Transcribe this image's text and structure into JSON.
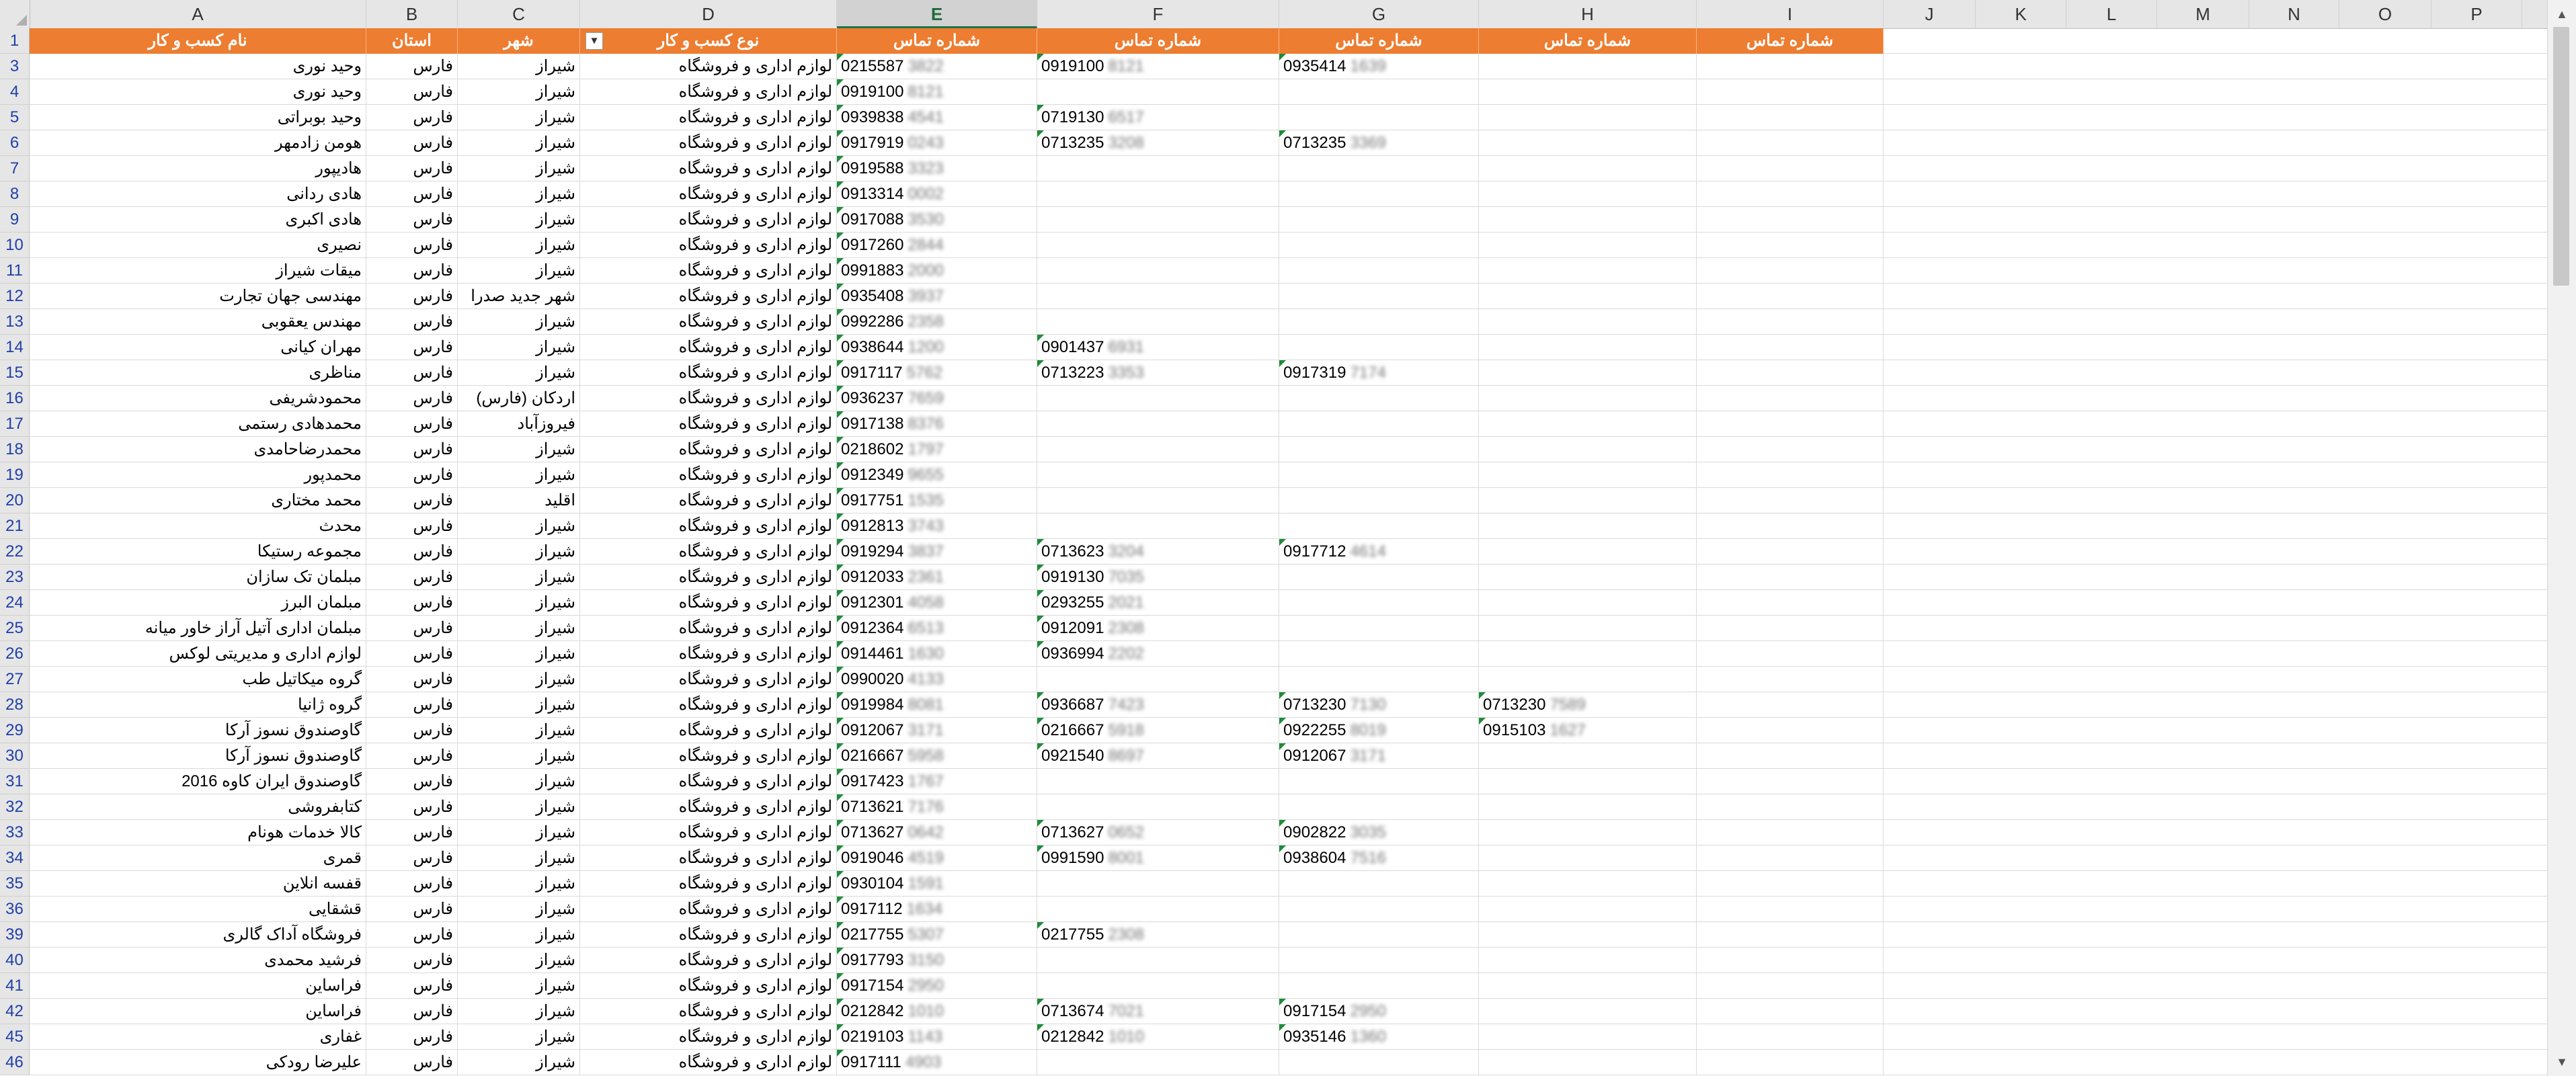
{
  "columns": {
    "A": "A",
    "B": "B",
    "C": "C",
    "D": "D",
    "E": "E",
    "F": "F",
    "G": "G",
    "H": "H",
    "I": "I",
    "J": "J",
    "K": "K",
    "L": "L",
    "M": "M",
    "N": "N",
    "O": "O",
    "P": "P"
  },
  "selected_column": "E",
  "header": {
    "row_number": "1",
    "business_name": "نام کسب و کار",
    "province": "استان",
    "city": "شهر",
    "business_type": "نوع کسب و کار",
    "phone_e": "شماره تماس",
    "phone_f": "شماره تماس",
    "phone_g": "شماره تماس",
    "phone_h": "شماره تماس",
    "phone_i": "شماره تماس"
  },
  "colors": {
    "header_fill": "#ed7d31",
    "header_text": "#ffffff",
    "selected_col": "#217346",
    "row_numbers": "#1f3fa8",
    "error_marker": "#1e8c3a"
  },
  "icons": {
    "filter": "filter-dropdown-icon",
    "scroll_up": "chevron-up-icon",
    "scroll_down": "chevron-down-icon"
  },
  "rows": [
    {
      "n": "3",
      "name": "وحید نوری",
      "province": "فارس",
      "city": "شیراز",
      "type": "لوازم اداری و فروشگاه",
      "e": "0215587",
      "eb": "3822",
      "f": "0919100",
      "fb": "8121",
      "g": "0935414",
      "gb": "1639",
      "h": "",
      "hb": ""
    },
    {
      "n": "4",
      "name": "وحید نوری",
      "province": "فارس",
      "city": "شیراز",
      "type": "لوازم اداری و فروشگاه",
      "e": "0919100",
      "eb": "8121",
      "f": "",
      "fb": "",
      "g": "",
      "gb": "",
      "h": "",
      "hb": ""
    },
    {
      "n": "5",
      "name": "وحید بوبراتی",
      "province": "فارس",
      "city": "شیراز",
      "type": "لوازم اداری و فروشگاه",
      "e": "0939838",
      "eb": "4541",
      "f": "0719130",
      "fb": "6517",
      "g": "",
      "gb": "",
      "h": "",
      "hb": ""
    },
    {
      "n": "6",
      "name": "هومن زادمهر",
      "province": "فارس",
      "city": "شیراز",
      "type": "لوازم اداری و فروشگاه",
      "e": "0917919",
      "eb": "0243",
      "f": "0713235",
      "fb": "3208",
      "g": "0713235",
      "gb": "3369",
      "h": "",
      "hb": ""
    },
    {
      "n": "7",
      "name": "هادیپور",
      "province": "فارس",
      "city": "شیراز",
      "type": "لوازم اداری و فروشگاه",
      "e": "0919588",
      "eb": "3323",
      "f": "",
      "fb": "",
      "g": "",
      "gb": "",
      "h": "",
      "hb": ""
    },
    {
      "n": "8",
      "name": "هادی ردانی",
      "province": "فارس",
      "city": "شیراز",
      "type": "لوازم اداری و فروشگاه",
      "e": "0913314",
      "eb": "0002",
      "f": "",
      "fb": "",
      "g": "",
      "gb": "",
      "h": "",
      "hb": ""
    },
    {
      "n": "9",
      "name": "هادی اکبری",
      "province": "فارس",
      "city": "شیراز",
      "type": "لوازم اداری و فروشگاه",
      "e": "0917088",
      "eb": "3530",
      "f": "",
      "fb": "",
      "g": "",
      "gb": "",
      "h": "",
      "hb": ""
    },
    {
      "n": "10",
      "name": "نصیری",
      "province": "فارس",
      "city": "شیراز",
      "type": "لوازم اداری و فروشگاه",
      "e": "0917260",
      "eb": "2844",
      "f": "",
      "fb": "",
      "g": "",
      "gb": "",
      "h": "",
      "hb": ""
    },
    {
      "n": "11",
      "name": "میقات شیراز",
      "province": "فارس",
      "city": "شیراز",
      "type": "لوازم اداری و فروشگاه",
      "e": "0991883",
      "eb": "2000",
      "f": "",
      "fb": "",
      "g": "",
      "gb": "",
      "h": "",
      "hb": ""
    },
    {
      "n": "12",
      "name": "مهندسی جهان تجارت",
      "province": "فارس",
      "city": "شهر جدید صدرا",
      "type": "لوازم اداری و فروشگاه",
      "e": "0935408",
      "eb": "3937",
      "f": "",
      "fb": "",
      "g": "",
      "gb": "",
      "h": "",
      "hb": ""
    },
    {
      "n": "13",
      "name": "مهندس یعقوبی",
      "province": "فارس",
      "city": "شیراز",
      "type": "لوازم اداری و فروشگاه",
      "e": "0992286",
      "eb": "2358",
      "f": "",
      "fb": "",
      "g": "",
      "gb": "",
      "h": "",
      "hb": ""
    },
    {
      "n": "14",
      "name": "مهران کیانی",
      "province": "فارس",
      "city": "شیراز",
      "type": "لوازم اداری و فروشگاه",
      "e": "0938644",
      "eb": "1200",
      "f": "0901437",
      "fb": "6931",
      "g": "",
      "gb": "",
      "h": "",
      "hb": ""
    },
    {
      "n": "15",
      "name": "مناظری",
      "province": "فارس",
      "city": "شیراز",
      "type": "لوازم اداری و فروشگاه",
      "e": "0917117",
      "eb": "5762",
      "f": "0713223",
      "fb": "3353",
      "g": "0917319",
      "gb": "7174",
      "h": "",
      "hb": ""
    },
    {
      "n": "16",
      "name": "محمودشریفی",
      "province": "فارس",
      "city": "اردکان (فارس)",
      "type": "لوازم اداری و فروشگاه",
      "e": "0936237",
      "eb": "7659",
      "f": "",
      "fb": "",
      "g": "",
      "gb": "",
      "h": "",
      "hb": ""
    },
    {
      "n": "17",
      "name": "محمدهادی رستمی",
      "province": "فارس",
      "city": "فیروزآباد",
      "type": "لوازم اداری و فروشگاه",
      "e": "0917138",
      "eb": "8376",
      "f": "",
      "fb": "",
      "g": "",
      "gb": "",
      "h": "",
      "hb": ""
    },
    {
      "n": "18",
      "name": "محمدرضاحامدی",
      "province": "فارس",
      "city": "شیراز",
      "type": "لوازم اداری و فروشگاه",
      "e": "0218602",
      "eb": "1797",
      "f": "",
      "fb": "",
      "g": "",
      "gb": "",
      "h": "",
      "hb": ""
    },
    {
      "n": "19",
      "name": "محمدپور",
      "province": "فارس",
      "city": "شیراز",
      "type": "لوازم اداری و فروشگاه",
      "e": "0912349",
      "eb": "9655",
      "f": "",
      "fb": "",
      "g": "",
      "gb": "",
      "h": "",
      "hb": ""
    },
    {
      "n": "20",
      "name": "محمد مختاری",
      "province": "فارس",
      "city": "اقلید",
      "type": "لوازم اداری و فروشگاه",
      "e": "0917751",
      "eb": "1535",
      "f": "",
      "fb": "",
      "g": "",
      "gb": "",
      "h": "",
      "hb": ""
    },
    {
      "n": "21",
      "name": "محدث",
      "province": "فارس",
      "city": "شیراز",
      "type": "لوازم اداری و فروشگاه",
      "e": "0912813",
      "eb": "3743",
      "f": "",
      "fb": "",
      "g": "",
      "gb": "",
      "h": "",
      "hb": ""
    },
    {
      "n": "22",
      "name": "مجموعه رستیکا",
      "province": "فارس",
      "city": "شیراز",
      "type": "لوازم اداری و فروشگاه",
      "e": "0919294",
      "eb": "3837",
      "f": "0713623",
      "fb": "3204",
      "g": "0917712",
      "gb": "4614",
      "h": "",
      "hb": ""
    },
    {
      "n": "23",
      "name": "مبلمان تک سازان",
      "province": "فارس",
      "city": "شیراز",
      "type": "لوازم اداری و فروشگاه",
      "e": "0912033",
      "eb": "2361",
      "f": "0919130",
      "fb": "7035",
      "g": "",
      "gb": "",
      "h": "",
      "hb": ""
    },
    {
      "n": "24",
      "name": "مبلمان البرز",
      "province": "فارس",
      "city": "شیراز",
      "type": "لوازم اداری و فروشگاه",
      "e": "0912301",
      "eb": "4058",
      "f": "0293255",
      "fb": "2021",
      "g": "",
      "gb": "",
      "h": "",
      "hb": ""
    },
    {
      "n": "25",
      "name": "مبلمان اداری آتیل آراز خاور میانه",
      "province": "فارس",
      "city": "شیراز",
      "type": "لوازم اداری و فروشگاه",
      "e": "0912364",
      "eb": "6513",
      "f": "0912091",
      "fb": "2308",
      "g": "",
      "gb": "",
      "h": "",
      "hb": ""
    },
    {
      "n": "26",
      "name": "لوازم اداری و مدیریتی لوکس",
      "province": "فارس",
      "city": "شیراز",
      "type": "لوازم اداری و فروشگاه",
      "e": "0914461",
      "eb": "1630",
      "f": "0936994",
      "fb": "2202",
      "g": "",
      "gb": "",
      "h": "",
      "hb": ""
    },
    {
      "n": "27",
      "name": "گروه میکاتیل طب",
      "province": "فارس",
      "city": "شیراز",
      "type": "لوازم اداری و فروشگاه",
      "e": "0990020",
      "eb": "4133",
      "f": "",
      "fb": "",
      "g": "",
      "gb": "",
      "h": "",
      "hb": ""
    },
    {
      "n": "28",
      "name": "گروه ژانیا",
      "province": "فارس",
      "city": "شیراز",
      "type": "لوازم اداری و فروشگاه",
      "e": "0919984",
      "eb": "8081",
      "f": "0936687",
      "fb": "7423",
      "g": "0713230",
      "gb": "7130",
      "h": "0713230",
      "hb": "7589"
    },
    {
      "n": "29",
      "name": "گاوصندوق نسوز آرکا",
      "province": "فارس",
      "city": "شیراز",
      "type": "لوازم اداری و فروشگاه",
      "e": "0912067",
      "eb": "3171",
      "f": "0216667",
      "fb": "5918",
      "g": "0922255",
      "gb": "8019",
      "h": "0915103",
      "hb": "1627"
    },
    {
      "n": "30",
      "name": "گاوصندوق نسوز آرکا",
      "province": "فارس",
      "city": "شیراز",
      "type": "لوازم اداری و فروشگاه",
      "e": "0216667",
      "eb": "5958",
      "f": "0921540",
      "fb": "8697",
      "g": "0912067",
      "gb": "3171",
      "h": "",
      "hb": ""
    },
    {
      "n": "31",
      "name": "گاوصندوق ایران کاوه 2016",
      "province": "فارس",
      "city": "شیراز",
      "type": "لوازم اداری و فروشگاه",
      "e": "0917423",
      "eb": "1767",
      "f": "",
      "fb": "",
      "g": "",
      "gb": "",
      "h": "",
      "hb": ""
    },
    {
      "n": "32",
      "name": "کتابفروشی",
      "province": "فارس",
      "city": "شیراز",
      "type": "لوازم اداری و فروشگاه",
      "e": "0713621",
      "eb": "7176",
      "f": "",
      "fb": "",
      "g": "",
      "gb": "",
      "h": "",
      "hb": ""
    },
    {
      "n": "33",
      "name": "کالا خدمات هونام",
      "province": "فارس",
      "city": "شیراز",
      "type": "لوازم اداری و فروشگاه",
      "e": "0713627",
      "eb": "0642",
      "f": "0713627",
      "fb": "0652",
      "g": "0902822",
      "gb": "3035",
      "h": "",
      "hb": ""
    },
    {
      "n": "34",
      "name": "قمری",
      "province": "فارس",
      "city": "شیراز",
      "type": "لوازم اداری و فروشگاه",
      "e": "0919046",
      "eb": "4519",
      "f": "0991590",
      "fb": "8001",
      "g": "0938604",
      "gb": "7516",
      "h": "",
      "hb": ""
    },
    {
      "n": "35",
      "name": "قفسه انلاین",
      "province": "فارس",
      "city": "شیراز",
      "type": "لوازم اداری و فروشگاه",
      "e": "0930104",
      "eb": "1591",
      "f": "",
      "fb": "",
      "g": "",
      "gb": "",
      "h": "",
      "hb": ""
    },
    {
      "n": "36",
      "name": "قشقایی",
      "province": "فارس",
      "city": "شیراز",
      "type": "لوازم اداری و فروشگاه",
      "e": "0917112",
      "eb": "1634",
      "f": "",
      "fb": "",
      "g": "",
      "gb": "",
      "h": "",
      "hb": ""
    },
    {
      "n": "39",
      "name": "فروشگاه آداک گالری",
      "province": "فارس",
      "city": "شیراز",
      "type": "لوازم اداری و فروشگاه",
      "e": "0217755",
      "eb": "5307",
      "f": "0217755",
      "fb": "2308",
      "g": "",
      "gb": "",
      "h": "",
      "hb": ""
    },
    {
      "n": "40",
      "name": "فرشید محمدی",
      "province": "فارس",
      "city": "شیراز",
      "type": "لوازم اداری و فروشگاه",
      "e": "0917793",
      "eb": "3150",
      "f": "",
      "fb": "",
      "g": "",
      "gb": "",
      "h": "",
      "hb": ""
    },
    {
      "n": "41",
      "name": "فراساین",
      "province": "فارس",
      "city": "شیراز",
      "type": "لوازم اداری و فروشگاه",
      "e": "0917154",
      "eb": "2950",
      "f": "",
      "fb": "",
      "g": "",
      "gb": "",
      "h": "",
      "hb": ""
    },
    {
      "n": "42",
      "name": "فراساین",
      "province": "فارس",
      "city": "شیراز",
      "type": "لوازم اداری و فروشگاه",
      "e": "0212842",
      "eb": "1010",
      "f": "0713674",
      "fb": "7021",
      "g": "0917154",
      "gb": "2950",
      "h": "",
      "hb": ""
    },
    {
      "n": "45",
      "name": "غفاری",
      "province": "فارس",
      "city": "شیراز",
      "type": "لوازم اداری و فروشگاه",
      "e": "0219103",
      "eb": "1143",
      "f": "0212842",
      "fb": "1010",
      "g": "0935146",
      "gb": "1360",
      "h": "",
      "hb": ""
    },
    {
      "n": "46",
      "name": "علیرضا رودکی",
      "province": "فارس",
      "city": "شیراز",
      "type": "لوازم اداری و فروشگاه",
      "e": "0917111",
      "eb": "4903",
      "f": "",
      "fb": "",
      "g": "",
      "gb": "",
      "h": "",
      "hb": ""
    }
  ]
}
